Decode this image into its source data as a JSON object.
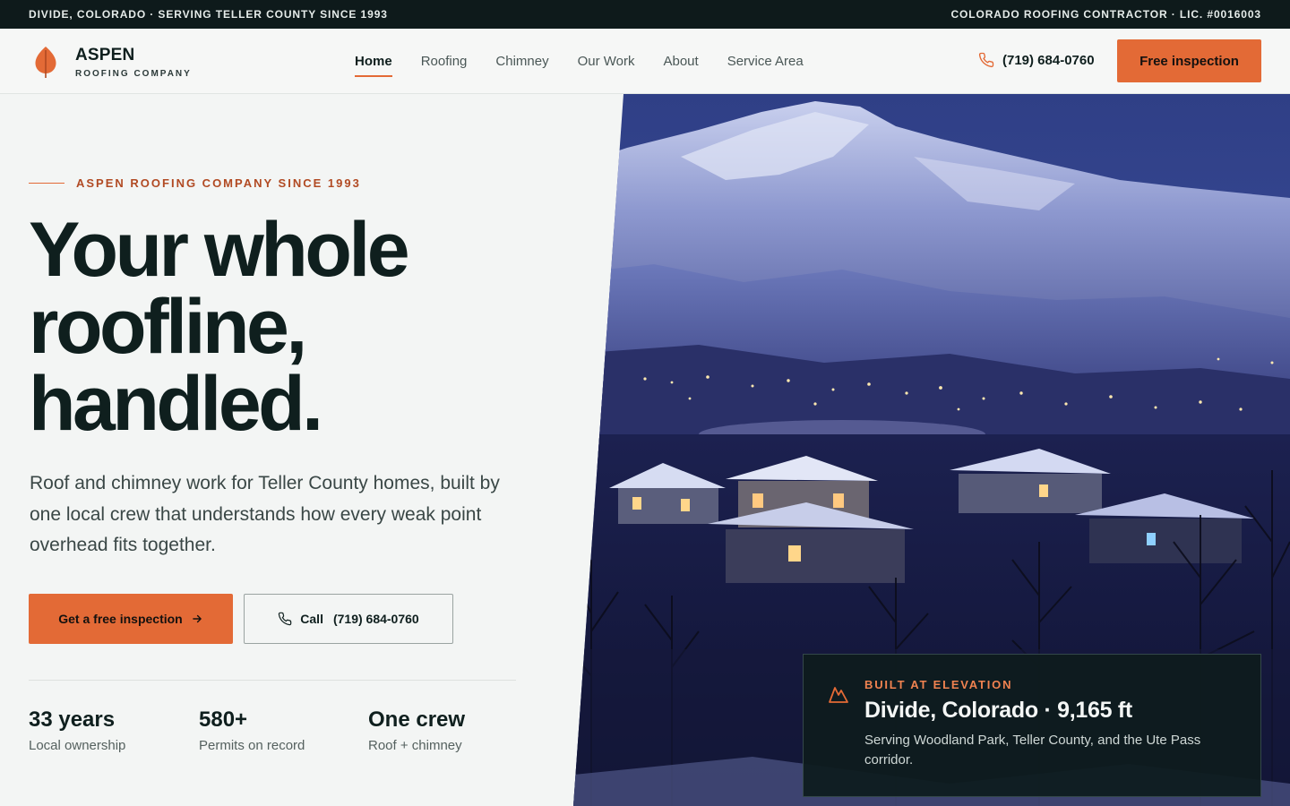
{
  "topbar": {
    "left_text": "DIVIDE, COLORADO · SERVING TELLER COUNTY SINCE 1993",
    "right_text": "COLORADO ROOFING CONTRACTOR · LIC. #0016003"
  },
  "header": {
    "brand_name": "ASPEN",
    "brand_sub": "ROOFING COMPANY",
    "nav": [
      {
        "label": "Home",
        "active": true
      },
      {
        "label": "Roofing"
      },
      {
        "label": "Chimney"
      },
      {
        "label": "Our Work"
      },
      {
        "label": "About"
      },
      {
        "label": "Service Area"
      }
    ],
    "phone": "(719) 684-0760",
    "cta_label": "Free inspection"
  },
  "hero": {
    "eyebrow": "ASPEN ROOFING COMPANY SINCE 1993",
    "headline_lines": [
      "Your whole",
      "roofline,",
      "handled."
    ],
    "lead": "Roof and chimney work for Teller County homes, built by one local crew that understands how every weak point overhead fits together.",
    "primary_cta": "Get a free inspection",
    "call_label": "Call",
    "call_number": "(719) 684-0760",
    "stats": [
      {
        "value": "33 years",
        "label": "Local ownership"
      },
      {
        "value": "580+",
        "label": "Permits on record"
      },
      {
        "value": "One crew",
        "label": "Roof + chimney"
      }
    ]
  },
  "card": {
    "eyebrow": "BUILT AT ELEVATION",
    "title": "Divide, Colorado · 9,165 ft",
    "text": "Serving Woodland Park, Teller County, and the Ute Pass corridor."
  },
  "colors": {
    "accent": "#e36a36",
    "dark": "#0e1a1b",
    "text": "#0f1f1e"
  },
  "icons": [
    "aspen-leaf-icon",
    "phone-icon",
    "arrow-right-icon",
    "mountain-icon"
  ]
}
